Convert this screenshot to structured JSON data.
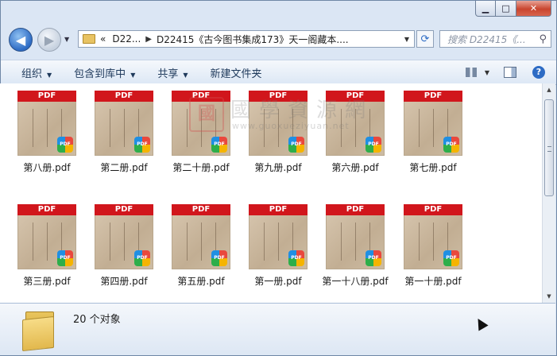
{
  "window": {
    "min_label": "▁",
    "max_label": "□",
    "close_label": "✕"
  },
  "nav": {
    "back_icon": "◀",
    "forward_icon": "▶",
    "address": {
      "prefix": "«",
      "crumb1": "D22...",
      "crumb2": "D22415《古今图书集成173》天一阁藏本....",
      "dropdown": "▼"
    },
    "refresh_icon": "⟳",
    "search_placeholder": "搜索 D22415《...",
    "search_icon": "⚲"
  },
  "toolbar": {
    "organize": "组织",
    "include_library": "包含到库中",
    "share": "共享",
    "new_folder": "新建文件夹",
    "help": "?"
  },
  "files": [
    {
      "name": "第八册.pdf",
      "badge": "PDF"
    },
    {
      "name": "第二册.pdf",
      "badge": "PDF"
    },
    {
      "name": "第二十册.pdf",
      "badge": "PDF"
    },
    {
      "name": "第九册.pdf",
      "badge": "PDF"
    },
    {
      "name": "第六册.pdf",
      "badge": "PDF"
    },
    {
      "name": "第七册.pdf",
      "badge": "PDF"
    },
    {
      "name": "第三册.pdf",
      "badge": "PDF"
    },
    {
      "name": "第四册.pdf",
      "badge": "PDF"
    },
    {
      "name": "第五册.pdf",
      "badge": "PDF"
    },
    {
      "name": "第一册.pdf",
      "badge": "PDF"
    },
    {
      "name": "第一十八册.pdf",
      "badge": "PDF"
    },
    {
      "name": "第一十册.pdf",
      "badge": "PDF"
    }
  ],
  "watermark": {
    "seal": "國",
    "text": "國學資源網",
    "url": "www.guoxueziyuan.net"
  },
  "status": {
    "count": "20 个对象"
  }
}
